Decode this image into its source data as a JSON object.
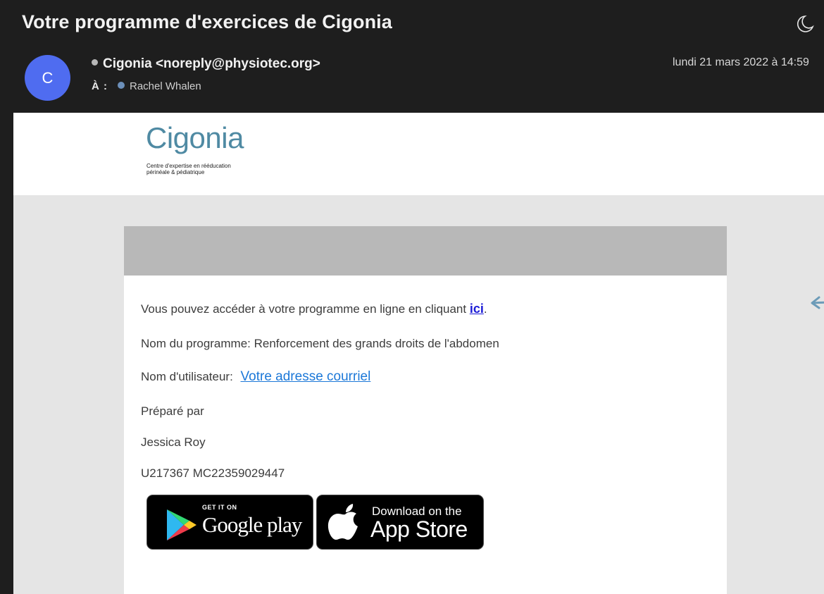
{
  "email": {
    "subject": "Votre programme d'exercices de Cigonia",
    "avatar_initial": "C",
    "sender": "Cigonia <noreply@physiotec.org>",
    "to_label": "À :",
    "recipient": "Rachel Whalen",
    "date": "lundi 21 mars 2022 à 14:59",
    "toolbar_icon": "moon-icon"
  },
  "brand": {
    "logo_name": "Cigonia",
    "tagline_line1": "Centre d'expertise en rééducation",
    "tagline_line2": "périnéale & pédiatrique",
    "color": "#4f8aa3"
  },
  "content": {
    "access_text": "Vous pouvez accéder à votre programme en ligne en cliquant ",
    "access_link": "ici",
    "access_end": ".",
    "program_line": "Nom du programme: Renforcement des grands droits de l'abdomen",
    "username_label": "Nom d'utilisateur: ",
    "username_link": "Votre adresse courriel",
    "prepared_by": "Préparé par",
    "preparer_name": "Jessica Roy",
    "codes": "U217367 MC22359029447"
  },
  "badges": {
    "google_small": "GET IT ON",
    "google_big": "Google play",
    "apple_small": "Download on the",
    "apple_big": "App Store"
  },
  "colors": {
    "avatar": "#4f6cf0",
    "link": "#1c78d8",
    "link_ici": "#1a1ad6",
    "body_bg": "#e5e5e5",
    "card_header": "#b8b8b8",
    "arrow": "#6c9bb8"
  }
}
